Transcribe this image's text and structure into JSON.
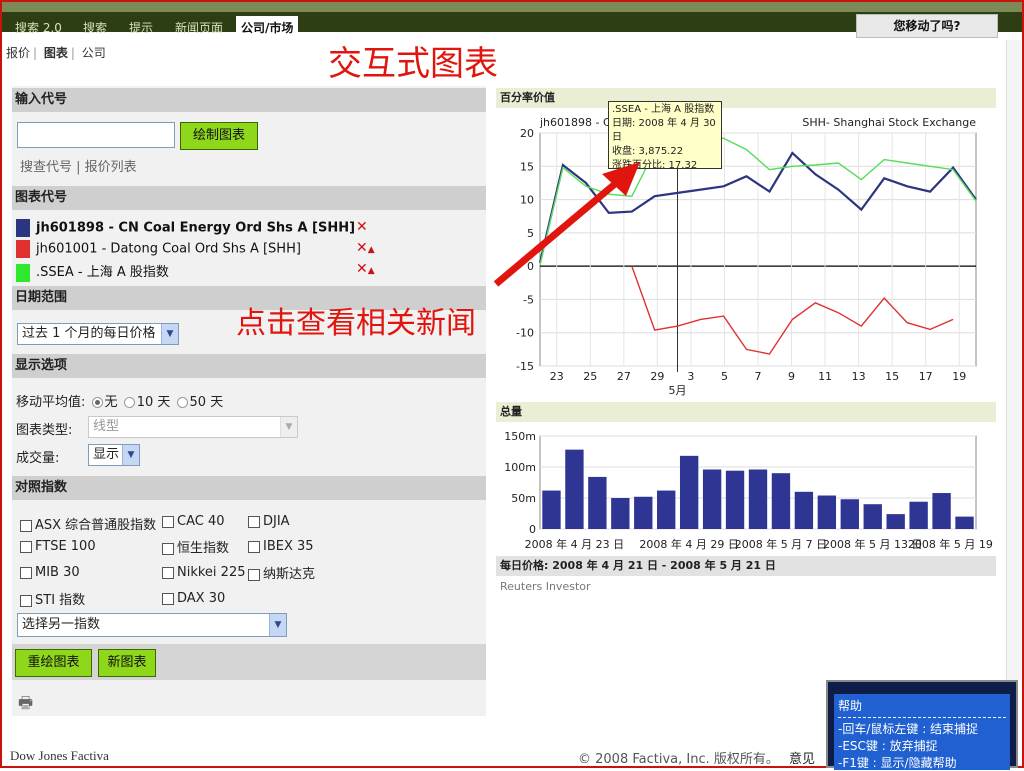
{
  "tabs": [
    "搜索 2.0",
    "搜索",
    "提示",
    "新闻页面",
    "公司/市场"
  ],
  "moved_label": "您移动了吗?",
  "subnav": [
    "报价",
    "图表",
    "公司"
  ],
  "annotations": {
    "title": "交互式图表",
    "arrow_text": "点击查看相关新闻"
  },
  "symbol_input": {
    "header": "输入代号",
    "value": "",
    "button": "绘制图表",
    "link_search": "搜查代号",
    "link_list": "报价列表"
  },
  "chart_symbols": {
    "header": "图表代号",
    "items": [
      {
        "label": "jh601898 - CN Coal Energy Ord Shs A [SHH]",
        "color": "#2b3580"
      },
      {
        "label": "jh601001 - Datong Coal Ord Shs A [SHH]",
        "color": "#e03030"
      },
      {
        "label": ".SSEA - 上海 A 股指数",
        "color": "#2ee82e"
      }
    ]
  },
  "date_range": {
    "header": "日期范围",
    "value": "过去 1 个月的每日价格"
  },
  "display_options": {
    "header": "显示选项",
    "ma_label": "移动平均值:",
    "ma_options": [
      "无",
      "10 天",
      "50 天"
    ],
    "chart_type_label": "图表类型:",
    "chart_type_value": "线型",
    "volume_label": "成交量:",
    "volume_value": "显示"
  },
  "compare": {
    "header": "对照指数",
    "indices": [
      "ASX 综合普通股指数",
      "CAC 40",
      "DJIA",
      "FTSE 100",
      "恒生指数",
      "IBEX 35",
      "MIB 30",
      "Nikkei 225",
      "纳斯达克",
      "STI 指数",
      "DAX 30"
    ],
    "select_other": "选择另一指数"
  },
  "buttons": {
    "redraw": "重绘图表",
    "new": "新图表"
  },
  "footer": {
    "brand": "Dow Jones Factiva",
    "copyright": "© 2008 Factiva, Inc. 版权所有。",
    "feedback": "意见"
  },
  "help": {
    "title": "帮助",
    "lines": [
      "-回车/鼠标左键 : 结束捕捉",
      "-ESC键 : 放弃捕捉",
      "-F1键 : 显示/隐藏帮助"
    ]
  },
  "chart_data": [
    {
      "type": "line",
      "title": "百分率价值",
      "legend_left": "jh601898 - CN",
      "legend_right": "SHH- Shanghai Stock Exchange",
      "x": [
        "4/21",
        "4/22",
        "4/23",
        "4/24",
        "4/25",
        "4/28",
        "4/29",
        "4/30",
        "5/5",
        "5/6",
        "5/7",
        "5/8",
        "5/9",
        "5/12",
        "5/13",
        "5/14",
        "5/15",
        "5/16",
        "5/19",
        "5/20"
      ],
      "x_tick_labels": [
        "23",
        "25",
        "27",
        "29",
        "3",
        "5",
        "7",
        "9",
        "11",
        "13",
        "15",
        "17",
        "19"
      ],
      "x_month_label": "5月",
      "ylim": [
        -15,
        20
      ],
      "y_ticks": [
        20,
        15,
        10,
        5,
        0,
        -5,
        -10,
        -15
      ],
      "series": [
        {
          "color": "#2b3580",
          "values": [
            0.5,
            15.2,
            12.5,
            8.0,
            8.2,
            10.5,
            11.0,
            11.5,
            12.0,
            13.5,
            11.2,
            17.0,
            13.8,
            11.5,
            8.5,
            13.2,
            12.0,
            11.2,
            14.8,
            10.0
          ]
        },
        {
          "color": "#e03030",
          "values": [
            null,
            null,
            null,
            null,
            0,
            -9.6,
            -9.0,
            -8.0,
            -7.5,
            -12.5,
            -13.2,
            -8.0,
            -5.5,
            -7.0,
            -9.0,
            -4.8,
            -8.5,
            -9.5,
            -8.0,
            null
          ]
        },
        {
          "color": "#55dd55",
          "values": [
            0.2,
            14.8,
            12.0,
            10.8,
            10.5,
            17.3,
            19.0,
            19.5,
            19.2,
            17.5,
            14.5,
            15.0,
            15.2,
            15.5,
            13.0,
            16.0,
            15.5,
            15.0,
            14.5,
            9.8
          ]
        }
      ],
      "tooltip": {
        "name": ".SSEA - 上海 A 股指数",
        "date": "日期: 2008 年 4 月 30 日",
        "close": "收盘: 3,875.22",
        "change": "涨跌百分比: 17.32"
      }
    },
    {
      "type": "bar",
      "title": "总量",
      "categories": [
        "4/21",
        "4/22",
        "4/23",
        "4/24",
        "4/25",
        "4/28",
        "4/29",
        "4/30",
        "5/5",
        "5/6",
        "5/7",
        "5/8",
        "5/9",
        "5/12",
        "5/13",
        "5/14",
        "5/15",
        "5/16",
        "5/19"
      ],
      "values": [
        62,
        128,
        84,
        50,
        52,
        62,
        118,
        96,
        94,
        96,
        90,
        60,
        54,
        48,
        40,
        24,
        44,
        58,
        20
      ],
      "ylim": [
        0,
        150
      ],
      "y_ticks": [
        "150m",
        "100m",
        "50m",
        "0"
      ],
      "x_tick_labels": [
        "2008 年 4 月 23 日",
        "2008 年 4 月 29 日",
        "2008 年 5 月 7 日",
        "2008 年 5 月 13 日",
        "2008 年 5 月 19 日"
      ],
      "note": "每日价格: 2008 年 4 月 21 日 - 2008 年 5 月 21 日",
      "source": "Reuters Investor"
    }
  ]
}
